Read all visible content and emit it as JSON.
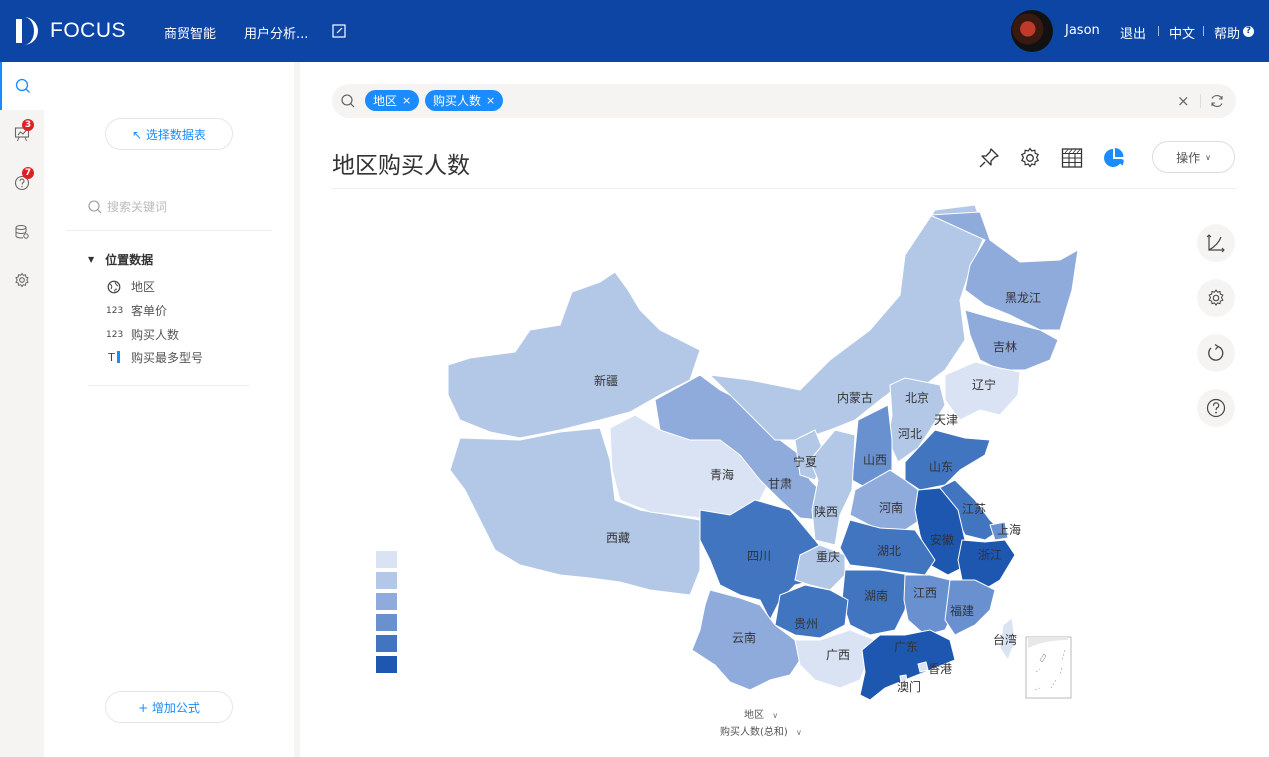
{
  "app": {
    "logo_text": "FOCUS",
    "nav": [
      "商贸智能",
      "用户分析..."
    ],
    "user": "Jason",
    "links": [
      "退出",
      "中文",
      "帮助"
    ],
    "help_glyph": "?"
  },
  "rail": {
    "items": [
      {
        "icon": "search-icon",
        "active": true
      },
      {
        "icon": "presentation-icon",
        "badge": "3"
      },
      {
        "icon": "question-icon",
        "badge": "7"
      },
      {
        "icon": "database-icon"
      },
      {
        "icon": "gear-icon"
      }
    ]
  },
  "panel": {
    "select_table": "↖ 选择数据表",
    "search_placeholder": "搜索关键词",
    "group": "位置数据",
    "fields": [
      {
        "icon": "globe-icon",
        "label": "地区"
      },
      {
        "icon": "number-icon",
        "label": "客单价"
      },
      {
        "icon": "number-icon",
        "label": "购买人数"
      },
      {
        "icon": "text-icon",
        "label": "购买最多型号"
      }
    ],
    "add_formula": "+ 增加公式"
  },
  "search": {
    "tags": [
      "地区",
      "购买人数"
    ],
    "tag_close": "×",
    "clear": "×"
  },
  "main": {
    "title": "地区购买人数",
    "op_button": "操作",
    "x_axis": "地区",
    "y_axis": "购买人数(总和)"
  },
  "colors": {
    "header": "#0d45a5",
    "accent": "#1a8cff",
    "scale": [
      "#d9e3f3",
      "#b3c8e7",
      "#8fabdb",
      "#6a91cf",
      "#4275c0",
      "#1d57b0"
    ]
  },
  "chart_data": {
    "type": "choropleth",
    "title": "地区购买人数",
    "metric": "购买人数(总和)",
    "dimension": "地区",
    "legend_bins": 6,
    "legend_placement": "bottom-left",
    "regions": [
      {
        "name": "新疆",
        "bin": 1
      },
      {
        "name": "西藏",
        "bin": 1
      },
      {
        "name": "青海",
        "bin": 0
      },
      {
        "name": "甘肃",
        "bin": 2
      },
      {
        "name": "内蒙古",
        "bin": 1
      },
      {
        "name": "黑龙江",
        "bin": 2
      },
      {
        "name": "吉林",
        "bin": 2
      },
      {
        "name": "辽宁",
        "bin": 0
      },
      {
        "name": "北京",
        "bin": 4
      },
      {
        "name": "天津",
        "bin": 0
      },
      {
        "name": "河北",
        "bin": 1
      },
      {
        "name": "山西",
        "bin": 3
      },
      {
        "name": "山东",
        "bin": 4
      },
      {
        "name": "宁夏",
        "bin": 1
      },
      {
        "name": "陕西",
        "bin": 1
      },
      {
        "name": "河南",
        "bin": 2
      },
      {
        "name": "江苏",
        "bin": 4
      },
      {
        "name": "上海",
        "bin": 3
      },
      {
        "name": "安徽",
        "bin": 5
      },
      {
        "name": "浙江",
        "bin": 5
      },
      {
        "name": "四川",
        "bin": 4
      },
      {
        "name": "重庆",
        "bin": 1
      },
      {
        "name": "湖北",
        "bin": 4
      },
      {
        "name": "湖南",
        "bin": 4
      },
      {
        "name": "江西",
        "bin": 3
      },
      {
        "name": "福建",
        "bin": 3
      },
      {
        "name": "贵州",
        "bin": 4
      },
      {
        "name": "云南",
        "bin": 2
      },
      {
        "name": "广西",
        "bin": 0
      },
      {
        "name": "广东",
        "bin": 5
      },
      {
        "name": "香港",
        "bin": 0
      },
      {
        "name": "澳门",
        "bin": 0
      },
      {
        "name": "台湾",
        "bin": 0
      }
    ]
  }
}
